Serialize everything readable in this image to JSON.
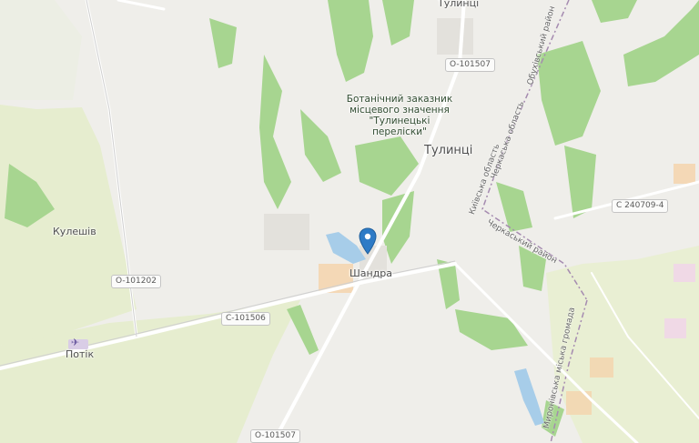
{
  "map": {
    "places": {
      "tulyntsi_top": "Тулинці",
      "tulyntsi": "Тулинці",
      "kuleshiv": "Кулешів",
      "shandra": "Шандра",
      "potik": "Потік"
    },
    "reserve_label": "Ботанічний заказник місцевого значення \"Тулинецькі перелiски\"",
    "roads": {
      "o101507_top": "O-101507",
      "o101202": "O-101202",
      "c101506": "C-101506",
      "c240709": "C 240709-4",
      "o101507_bottom": "O-101507"
    },
    "boundaries": {
      "obukhiv_raion": "Обухівський район",
      "kyiv_oblast": "Київська область",
      "cherkasy_oblast": "Черкаська область",
      "cherkasy_raion": "Черкаський район",
      "myronivka_hromada": "Миронівська міська громада"
    },
    "marker": "location-pin",
    "colors": {
      "background": "#efeeea",
      "forest": "#a7d590",
      "farmland": "#e6edcf",
      "water": "#a7cde9",
      "road": "#ffffff",
      "marker": "#2e7bc6"
    }
  }
}
